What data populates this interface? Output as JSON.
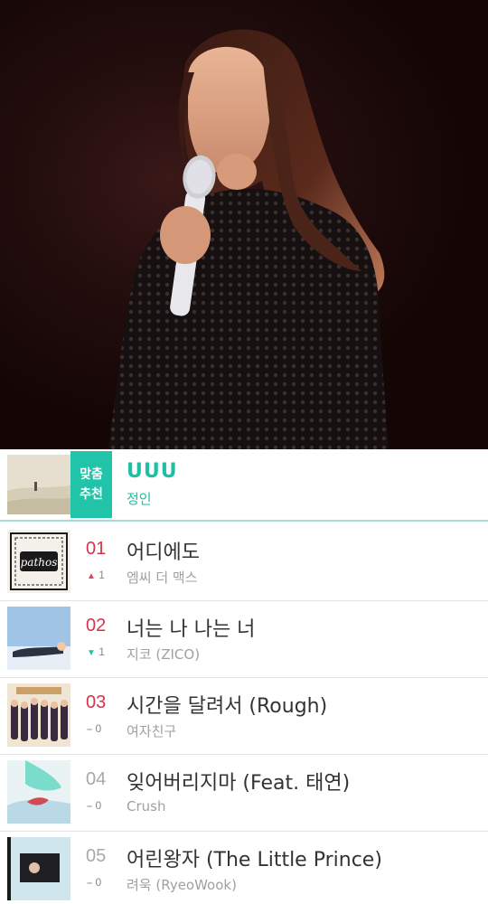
{
  "photo": {
    "subject": "singer-with-microphone-photo"
  },
  "recommend": {
    "badge_line1": "맞춤",
    "badge_line2": "추천",
    "title": "UUU",
    "artist": "정인"
  },
  "chart": [
    {
      "rank": "01",
      "change": "1",
      "direction": "up",
      "title": "어디에도",
      "artist": "엠씨 더 맥스",
      "album_text": "pathos"
    },
    {
      "rank": "02",
      "change": "1",
      "direction": "down",
      "title": "너는 나 나는 너",
      "artist": "지코 (ZICO)"
    },
    {
      "rank": "03",
      "change": "0",
      "direction": "same",
      "title": "시간을 달려서 (Rough)",
      "artist": "여자친구"
    },
    {
      "rank": "04",
      "change": "0",
      "direction": "same",
      "title": "잊어버리지마 (Feat. 태연)",
      "artist": "Crush"
    },
    {
      "rank": "05",
      "change": "0",
      "direction": "same",
      "title": "어린왕자 (The Little Prince)",
      "artist": "려욱 (RyeoWook)"
    }
  ],
  "colors": {
    "accent": "#21c4a8",
    "rank_hot": "#d8324a",
    "rank_cold": "#a8a8a8",
    "up": "#e0455c",
    "down": "#21c4a8"
  }
}
